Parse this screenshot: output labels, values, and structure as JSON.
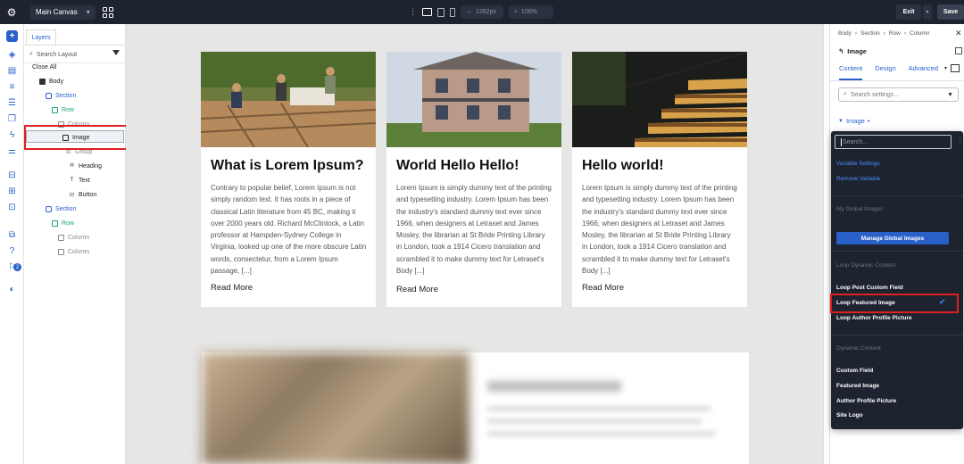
{
  "topbar": {
    "canvas_label": "Main Canvas",
    "canvas_chevron": "▾",
    "width_value": "1262px",
    "zoom_value": "100%",
    "exit_label": "Exit",
    "exit_arrow": "▾",
    "save_label": "Save"
  },
  "layers": {
    "tab_label": "Layers",
    "search_placeholder": "Search Layout",
    "close_all": "Close All",
    "tree": {
      "body": "Body",
      "section1": "Section",
      "row1": "Row",
      "column1": "Column",
      "image": "Image",
      "group": "Group",
      "heading": "Heading",
      "text": "Text",
      "button": "Button",
      "section2": "Section",
      "row2": "Row",
      "column2": "Column",
      "column3": "Column"
    }
  },
  "rail": {
    "badge": "2"
  },
  "cards": [
    {
      "title": "What is Lorem Ipsum?",
      "body": "Contrary to popular belief, Lorem Ipsum is not simply random text. It has roots in a piece of classical Latin literature from 45 BC, making it over 2000 years old. Richard McClintock, a Latin professor at Hampden-Sydney College in Virginia, looked up one of the more obscure Latin words, consectetur, from a Lorem Ipsum passage, [...]",
      "more": "Read More"
    },
    {
      "title": "World Hello Hello!",
      "body": "Lorem Ipsum is simply dummy text of the printing and typesetting industry. Lorem Ipsum has been the industry's standard dummy text ever since 1966, when designers at Letraset and James Mosley, the librarian at St Bride Printing Library in London, took a 1914 Cicero translation and scrambled it to make dummy text for Letraset's Body [...]",
      "more": "Read More"
    },
    {
      "title": "Hello world!",
      "body": "Lorem Ipsum is simply dummy text of the printing and typesetting industry. Lorem Ipsum has been the industry's standard dummy text ever since 1966, when designers at Letraset and James Mosley, the librarian at St Bride Printing Library in London, took a 1914 Cicero translation and scrambled it to make dummy text for Letraset's Body [...]",
      "more": "Read More"
    }
  ],
  "right_panel": {
    "breadcrumb": [
      "Body",
      "›",
      "Section",
      "›",
      "Row",
      "›",
      "Column"
    ],
    "element_label": "Image",
    "tabs": [
      "Content",
      "Design",
      "Advanced"
    ],
    "search_placeholder": "Search settings...",
    "section_label": "Image",
    "section_dot": "•"
  },
  "dropdown": {
    "search_placeholder": "Search...",
    "variable_settings": "Variable Settings",
    "remove_variable": "Remove Variable",
    "global_heading": "My Global Images",
    "manage_button": "Manage Global Images",
    "loop_heading": "Loop Dynamic Content",
    "loop_items": [
      "Loop Post Custom Field",
      "Loop Featured Image",
      "Loop Author Profile Picture"
    ],
    "dynamic_heading": "Dynamic Content",
    "dynamic_items": [
      "Custom Field",
      "Featured Image",
      "Author Profile Picture",
      "Site Logo"
    ]
  },
  "colors": {
    "accent": "#2a61c9",
    "topbar_bg": "#1e2330",
    "highlight_red": "#e01f1f",
    "tree_green": "#1da86b"
  }
}
